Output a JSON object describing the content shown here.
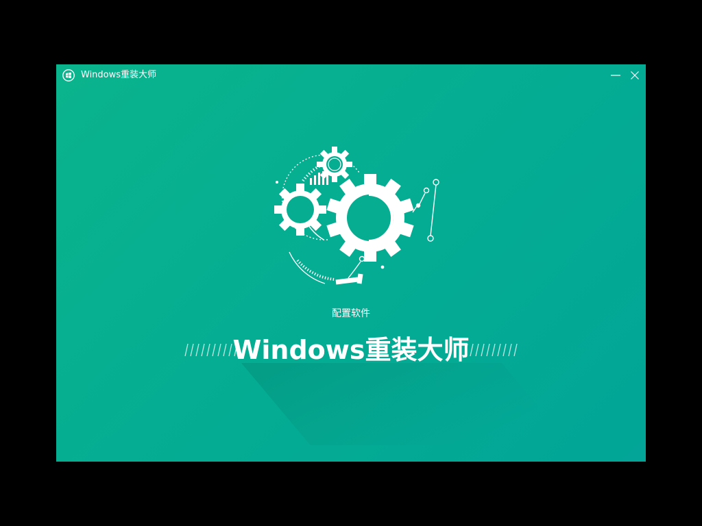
{
  "window": {
    "title": "Windows重装大师",
    "colors": {
      "background_start": "#0ab48c",
      "background_end": "#02a597",
      "foreground": "#ffffff"
    }
  },
  "titlebar": {
    "app_icon": "windows-logo-icon",
    "minimize_icon": "minimize-icon",
    "close_icon": "close-icon"
  },
  "illustration": {
    "icon": "gears-icon"
  },
  "status": {
    "text": "配置软件"
  },
  "brand": {
    "text": "Windows重装大师"
  }
}
